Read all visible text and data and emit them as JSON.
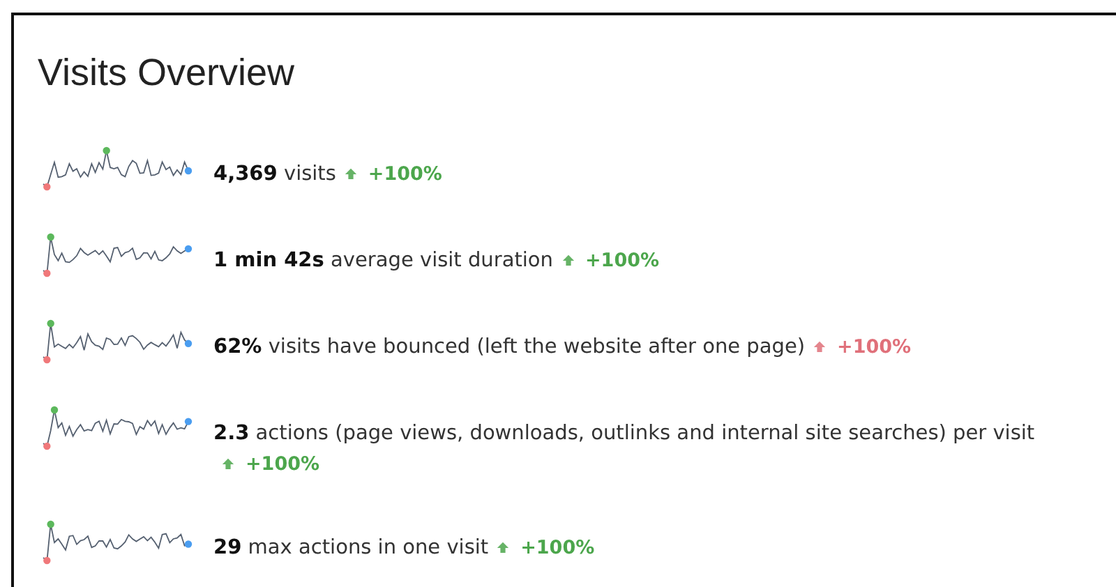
{
  "widget": {
    "title": "Visits Overview",
    "metrics": [
      {
        "text": "**4,369** visits",
        "change": "+100%",
        "color": "#4ca64c"
      },
      {
        "text": "**1 min 42s** average visit duration",
        "change": "+100%",
        "color": "#4ca64c"
      },
      {
        "text": "**62%** visits have bounced (left the website after one page)",
        "change": "+100%",
        "color": "#e0707a"
      },
      {
        "text": "**2.3** actions (page views, downloads, outlinks and internal site searches) per visit",
        "change": "+100%",
        "color": "#4ca64c"
      },
      {
        "text": "**29** max actions in one visit",
        "change": "+100%",
        "color": "#4ca64c"
      }
    ]
  }
}
